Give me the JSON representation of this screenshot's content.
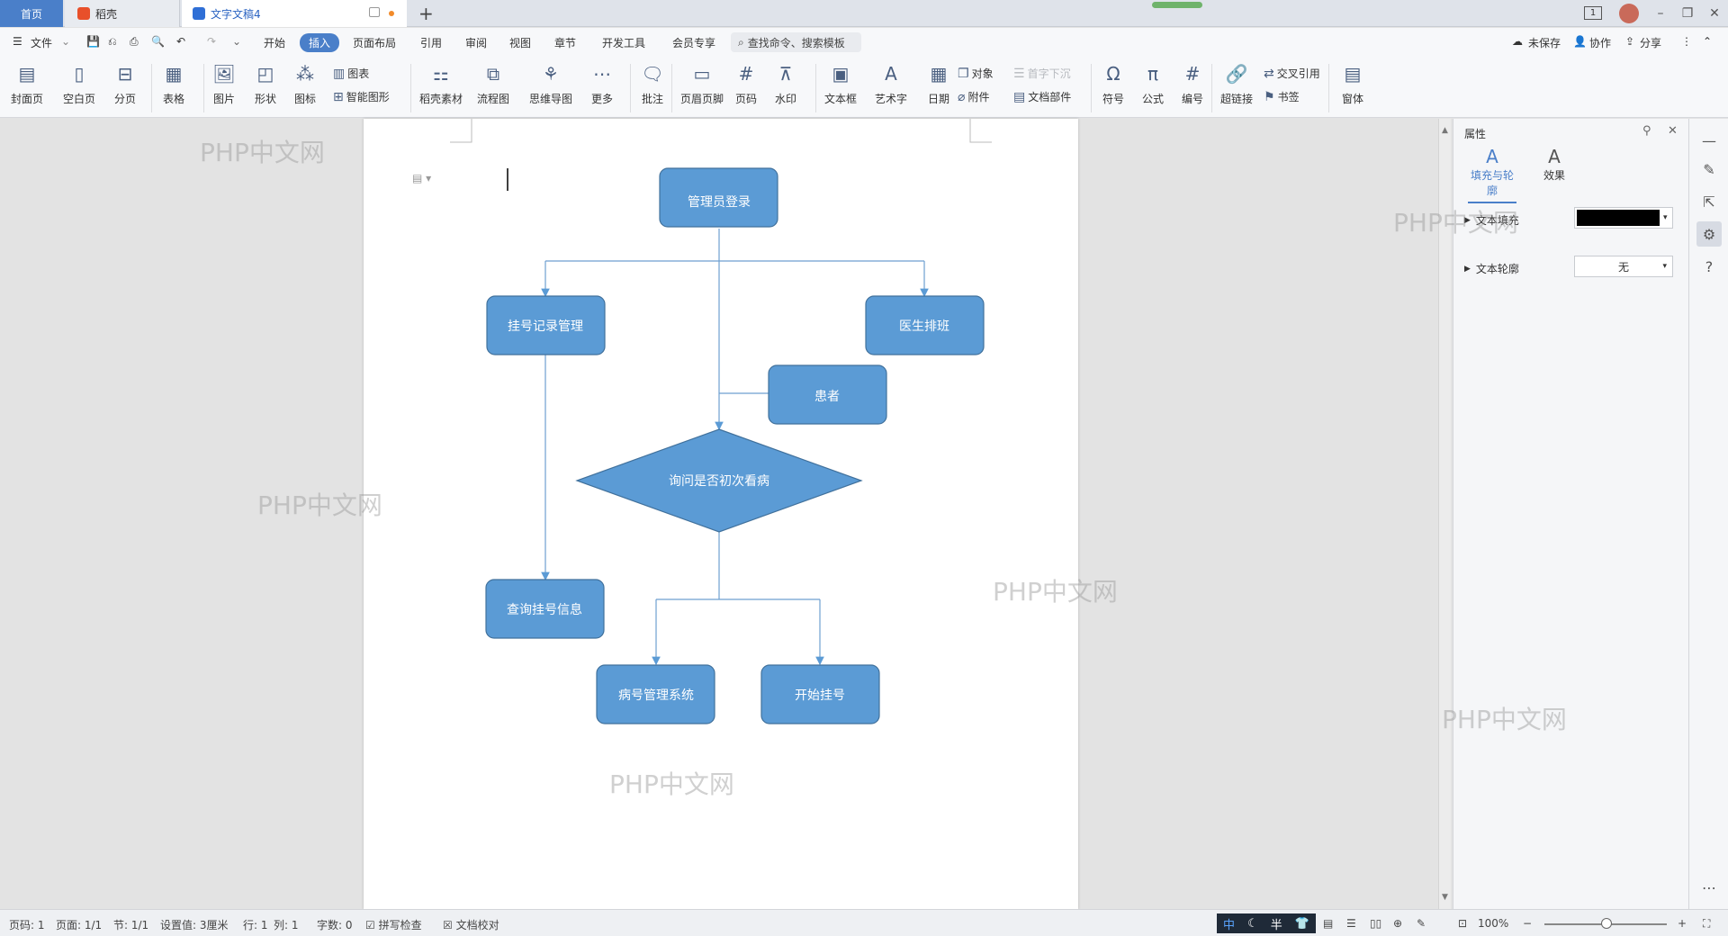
{
  "tabs": {
    "home": "首页",
    "daoke": "稻壳",
    "document": "文字文稿4"
  },
  "menu": {
    "file": "文件",
    "items": [
      "开始",
      "插入",
      "页面布局",
      "引用",
      "审阅",
      "视图",
      "章节",
      "开发工具",
      "会员专享"
    ],
    "active": "插入",
    "search": "查找命令、搜索模板",
    "unsaved": "未保存",
    "collab": "协作",
    "share": "分享"
  },
  "ribbon": {
    "cover": "封面页",
    "blank": "空白页",
    "pagebreak": "分页",
    "table": "表格",
    "picture": "图片",
    "shape": "形状",
    "icon": "图标",
    "chart": "图表",
    "smart": "智能图形",
    "daoke_material": "稻壳素材",
    "flowchart": "流程图",
    "mindmap": "思维导图",
    "more": "更多",
    "comment": "批注",
    "header_footer": "页眉页脚",
    "page_number": "页码",
    "watermark": "水印",
    "textbox": "文本框",
    "wordart": "艺术字",
    "date": "日期",
    "object": "对象",
    "attachment": "附件",
    "dropcap": "首字下沉",
    "doc_parts": "文档部件",
    "symbol": "符号",
    "formula": "公式",
    "numbering": "编号",
    "hyperlink": "超链接",
    "crossref": "交叉引用",
    "bookmark": "书签",
    "window": "窗体"
  },
  "flowchart": {
    "admin_login": "管理员登录",
    "register_records": "挂号记录管理",
    "doctor_schedule": "医生排班",
    "patient": "患者",
    "decision": "询问是否初次看病",
    "query_register": "查询挂号信息",
    "case_number": "病号管理系统",
    "start_register": "开始挂号"
  },
  "panel": {
    "title": "属性",
    "tab_fill": "填充与轮廓",
    "tab_effect": "效果",
    "text_fill": "文本填充",
    "text_outline": "文本轮廓",
    "outline_value": "无",
    "fill_color": "#000000"
  },
  "status": {
    "page_code": "页码: 1",
    "pages": "页面: 1/1",
    "section": "节: 1/1",
    "setting": "设置值: 3厘米",
    "row": "行: 1",
    "col": "列: 1",
    "words": "字数: 0",
    "spell": "拼写检查",
    "proof": "文档校对",
    "zoom": "100%",
    "ime": "中",
    "half": "半"
  },
  "watermarks": [
    "PHP中文网",
    "PHP中文网",
    "PHP中文网",
    "PHP中文网",
    "PHP中文网",
    "PHP中文网"
  ],
  "colors": {
    "accent": "#4a7fc9",
    "shape_fill": "#5b9bd5",
    "shape_stroke": "#41719c"
  }
}
